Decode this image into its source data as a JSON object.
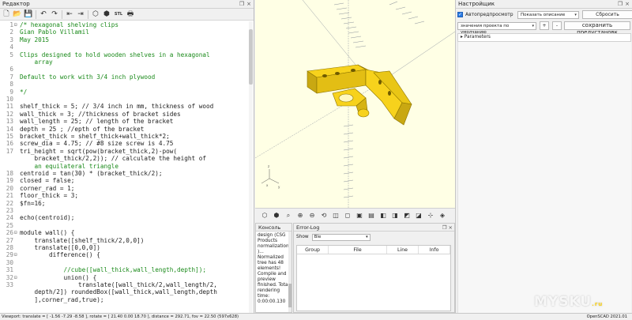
{
  "editor": {
    "title": "Редактор",
    "toolbar_icons": [
      "new-file-icon",
      "open-file-icon",
      "save-icon",
      "undo-icon",
      "redo-icon",
      "unindent-icon",
      "indent-icon",
      "preview-icon",
      "render-icon",
      "export-stl-icon",
      "send-to-print-icon"
    ],
    "stl_label": "STL",
    "lines": [
      {
        "n": "1",
        "fold": "⊟",
        "cls": "c-comment",
        "text": "/* hexagonal shelving clips"
      },
      {
        "n": "2",
        "fold": "",
        "cls": "c-comment",
        "text": "Gian Pablo Villamil"
      },
      {
        "n": "3",
        "fold": "",
        "cls": "c-comment",
        "text": "May 2015"
      },
      {
        "n": "4",
        "fold": "",
        "cls": "c-comment",
        "text": ""
      },
      {
        "n": "5",
        "fold": "",
        "cls": "c-comment",
        "text": "Clips designed to hold wooden shelves in a hexagonal"
      },
      {
        "n": "",
        "fold": "",
        "cls": "c-comment",
        "text": "    array"
      },
      {
        "n": "6",
        "fold": "",
        "cls": "c-comment",
        "text": ""
      },
      {
        "n": "7",
        "fold": "",
        "cls": "c-comment",
        "text": "Default to work with 3/4 inch plywood"
      },
      {
        "n": "8",
        "fold": "",
        "cls": "c-comment",
        "text": ""
      },
      {
        "n": "9",
        "fold": "",
        "cls": "c-comment",
        "text": "*/"
      },
      {
        "n": "10",
        "fold": "",
        "cls": "",
        "text": ""
      },
      {
        "n": "11",
        "fold": "",
        "cls": "",
        "text": "shelf_thick = 5; // 3/4 inch in mm, thickness of wood"
      },
      {
        "n": "12",
        "fold": "",
        "cls": "",
        "text": "wall_thick = 3; //thickness of bracket sides"
      },
      {
        "n": "13",
        "fold": "",
        "cls": "",
        "text": "wall_length = 25; // length of the bracket"
      },
      {
        "n": "14",
        "fold": "",
        "cls": "",
        "text": "depth = 25 ; //epth of the bracket"
      },
      {
        "n": "15",
        "fold": "",
        "cls": "",
        "text": "bracket_thick = shelf_thick+wall_thick*2;"
      },
      {
        "n": "16",
        "fold": "",
        "cls": "",
        "text": "screw_dia = 4.75; // #8 size screw is 4.75"
      },
      {
        "n": "17",
        "fold": "",
        "cls": "",
        "text": "tri_height = sqrt(pow(bracket_thick,2)-pow("
      },
      {
        "n": "",
        "fold": "",
        "cls": "",
        "text": "    bracket_thick/2,2)); // calculate the height of"
      },
      {
        "n": "",
        "fold": "",
        "cls": "c-comment",
        "text": "    an equilateral triangle"
      },
      {
        "n": "18",
        "fold": "",
        "cls": "",
        "text": "centroid = tan(30) * (bracket_thick/2);"
      },
      {
        "n": "19",
        "fold": "",
        "cls": "",
        "text": "closed = false;"
      },
      {
        "n": "20",
        "fold": "",
        "cls": "",
        "text": "corner_rad = 1;"
      },
      {
        "n": "21",
        "fold": "",
        "cls": "",
        "text": "floor_thick = 3;"
      },
      {
        "n": "22",
        "fold": "",
        "cls": "",
        "text": "$fn=16;"
      },
      {
        "n": "23",
        "fold": "",
        "cls": "",
        "text": ""
      },
      {
        "n": "24",
        "fold": "",
        "cls": "",
        "text": "echo(centroid);"
      },
      {
        "n": "25",
        "fold": "",
        "cls": "",
        "text": ""
      },
      {
        "n": "26",
        "fold": "⊟",
        "cls": "",
        "text": "module wall() {"
      },
      {
        "n": "27",
        "fold": "",
        "cls": "",
        "text": "    translate([shelf_thick/2,0,0])"
      },
      {
        "n": "28",
        "fold": "",
        "cls": "",
        "text": "    translate([0,0,0])"
      },
      {
        "n": "29",
        "fold": "⊟",
        "cls": "",
        "text": "        difference() {"
      },
      {
        "n": "30",
        "fold": "",
        "cls": "",
        "text": ""
      },
      {
        "n": "31",
        "fold": "",
        "cls": "c-comment",
        "text": "            //cube([wall_thick,wall_length,depth]);"
      },
      {
        "n": "32",
        "fold": "⊟",
        "cls": "",
        "text": "            union() {"
      },
      {
        "n": "33",
        "fold": "",
        "cls": "",
        "text": "                translate([wall_thick/2,wall_length/2,"
      },
      {
        "n": "",
        "fold": "",
        "cls": "",
        "text": "    depth/2]) roundedBox([wall_thick,wall_length,depth"
      },
      {
        "n": "",
        "fold": "",
        "cls": "",
        "text": "    ],corner_rad,true);"
      }
    ]
  },
  "viewport": {
    "toolbar_icons": [
      "preview-icon",
      "render-icon",
      "zoom-all-icon",
      "zoom-in-icon",
      "zoom-out-icon",
      "reset-view-icon",
      "perspective-icon",
      "orthographic-icon",
      "view-top-icon",
      "view-bottom-icon",
      "view-left-icon",
      "view-right-icon",
      "view-front-icon",
      "view-back-icon",
      "show-axes-icon",
      "show-edges-icon"
    ],
    "model_color": "#f7d21c",
    "background_color": "#ffffe5"
  },
  "console": {
    "title": "Консоль",
    "text": "design (CSG Products normalization)... Normalized tree has 48 elements! Compile and preview finished. Total rendering time: 0:00:00.130"
  },
  "errorlog": {
    "title": "Error-Log",
    "show_label": "Show",
    "show_value": "Ble",
    "columns": [
      "Group",
      "File",
      "Line",
      "Info"
    ]
  },
  "customizer": {
    "title": "Настройщик",
    "auto_preview_label": "Автопредпросмотр",
    "description_dropdown": "Показать описание",
    "reset_button": "Сбросить",
    "preset_dropdown": "значения проекта по умолчанию",
    "add_button": "+",
    "remove_button": "-",
    "save_preset_button": "сохранить предустановк",
    "parameters_label": "Parameters"
  },
  "statusbar": {
    "text": "Viewport: translate = [ -1.56 -7.29 -8.58 ], rotate = [ 21.40 0.00 18.70 ], distance = 292.71, fov = 22.50 (597x628)",
    "version": "OpenSCAD 2021.01"
  },
  "watermark": {
    "text": "MYSKU",
    "suffix": ".ru"
  }
}
